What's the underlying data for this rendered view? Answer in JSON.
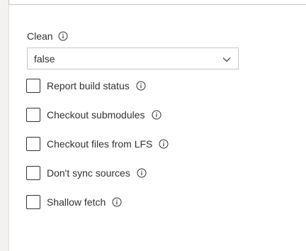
{
  "clean": {
    "label": "Clean",
    "info_icon": "info-icon",
    "selected_value": "false",
    "chevron_icon": "chevron-down-icon"
  },
  "options": [
    {
      "label": "Report build status",
      "checked": false,
      "info_icon": "info-icon"
    },
    {
      "label": "Checkout submodules",
      "checked": false,
      "info_icon": "info-icon"
    },
    {
      "label": "Checkout files from LFS",
      "checked": false,
      "info_icon": "info-icon"
    },
    {
      "label": "Don't sync sources",
      "checked": false,
      "info_icon": "info-icon"
    },
    {
      "label": "Shallow fetch",
      "checked": false,
      "info_icon": "info-icon"
    }
  ]
}
